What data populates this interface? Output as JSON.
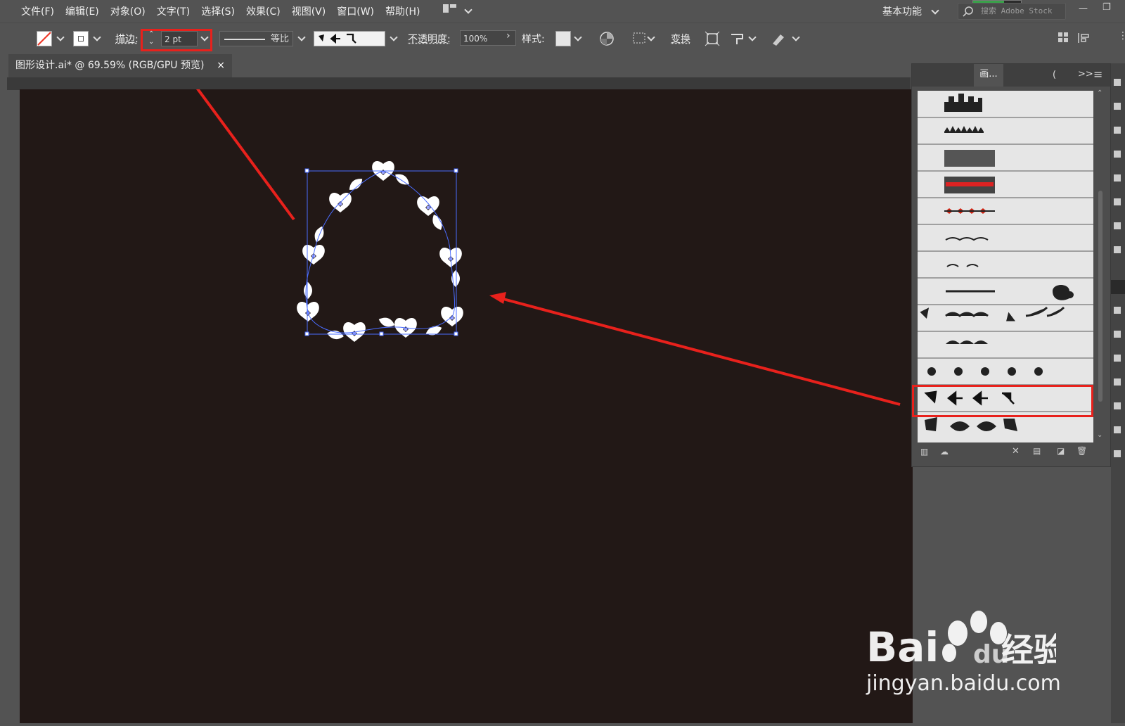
{
  "menu": [
    "文件(F)",
    "编辑(E)",
    "对象(O)",
    "文字(T)",
    "选择(S)",
    "效果(C)",
    "视图(V)",
    "窗口(W)",
    "帮助(H)"
  ],
  "workspace": {
    "label": "基本功能",
    "search_placeholder": "搜索 Adobe Stock",
    "progress": 0.65
  },
  "control": {
    "stroke_label": "描边:",
    "stroke_value": "2 pt",
    "profile_label": "等比",
    "opacity_label": "不透明度:",
    "opacity_value": "100%",
    "style_label": "样式:",
    "transform_label": "变换"
  },
  "document": {
    "tab_title": "图形设计.ai* @ 69.59% (RGB/GPU 预览)",
    "close_glyph": "×"
  },
  "panel": {
    "tab_label": "画...",
    "expand_glyph": ">>"
  },
  "brush_rows": [
    "buildings",
    "grass",
    "dots-grid",
    "hearts-grid",
    "diamonds-red",
    "vines",
    "leaves-small",
    "swirl-ornament",
    "waves",
    "scroll-border",
    "dots",
    "heart-leaf-selected",
    "leaf-shapes"
  ],
  "watermark": {
    "brand": "Bai",
    "brand2": "du",
    "cn": "经验",
    "url": "jingyan.baidu.com"
  },
  "colors": {
    "canvas": "#221816",
    "ui": "#535353",
    "highlight": "#e8211c",
    "selection": "#4a6cff"
  }
}
